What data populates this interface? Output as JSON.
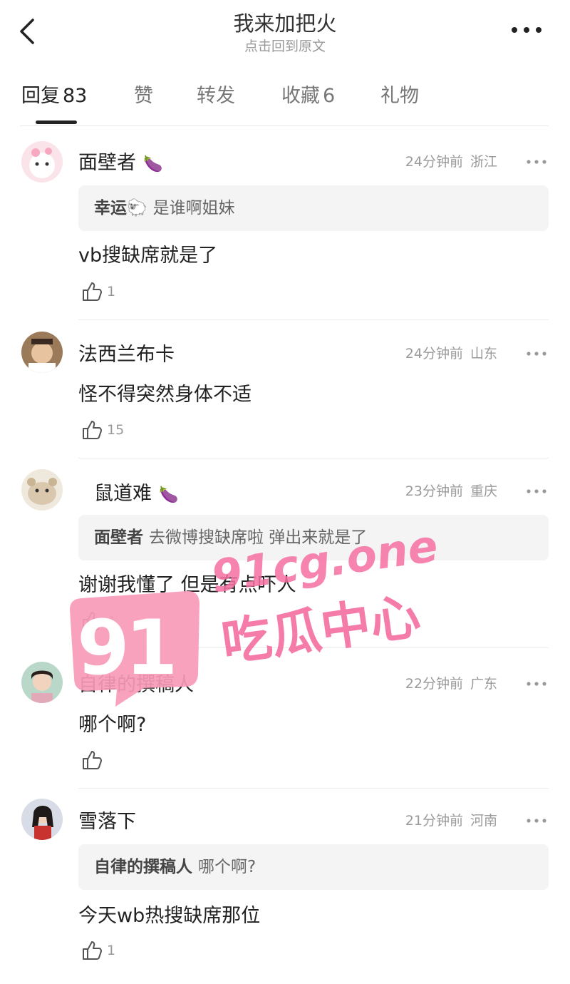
{
  "header": {
    "title": "我来加把火",
    "subtitle": "点击回到原文",
    "back_icon": "chevron-left-icon",
    "more_icon": "more-horizontal-icon"
  },
  "tabs": [
    {
      "label": "回复",
      "count": "83",
      "active": true
    },
    {
      "label": "赞",
      "count": ""
    },
    {
      "label": "转发",
      "count": ""
    },
    {
      "label": "收藏",
      "count": "6"
    },
    {
      "label": "礼物",
      "count": ""
    }
  ],
  "comments": [
    {
      "user": "面壁者",
      "badge": "🍆",
      "time": "24分钟前",
      "region": "浙江",
      "quote_user": "幸运🐑",
      "quote_text": "是谁啊姐妹",
      "text": "vb搜缺席就是了",
      "likes": "1"
    },
    {
      "user": "法西兰布卡",
      "badge": "",
      "time": "24分钟前",
      "region": "山东",
      "text": "怪不得突然身体不适",
      "likes": "15"
    },
    {
      "user": "鼠道难",
      "badge": "🍆",
      "time": "23分钟前",
      "region": "重庆",
      "quote_user": "面壁者",
      "quote_text": "去微博搜缺席啦 弹出来就是了",
      "text": "谢谢我懂了 但是有点吓人",
      "likes": "4"
    },
    {
      "user": "自律的撰稿人",
      "badge": "",
      "time": "22分钟前",
      "region": "广东",
      "text": "哪个啊?",
      "likes": ""
    },
    {
      "user": "雪落下",
      "badge": "",
      "time": "21分钟前",
      "region": "河南",
      "quote_user": "自律的撰稿人",
      "quote_text": "哪个啊?",
      "text": "今天wb热搜缺席那位",
      "likes": "1"
    }
  ],
  "watermark": {
    "logo": "91",
    "site": "91cg.one",
    "name": "吃瓜中心",
    "color": "#f46ea0"
  },
  "colors": {
    "text_primary": "#222222",
    "text_secondary": "#9a9a9a",
    "quote_bg": "#f4f4f4"
  }
}
